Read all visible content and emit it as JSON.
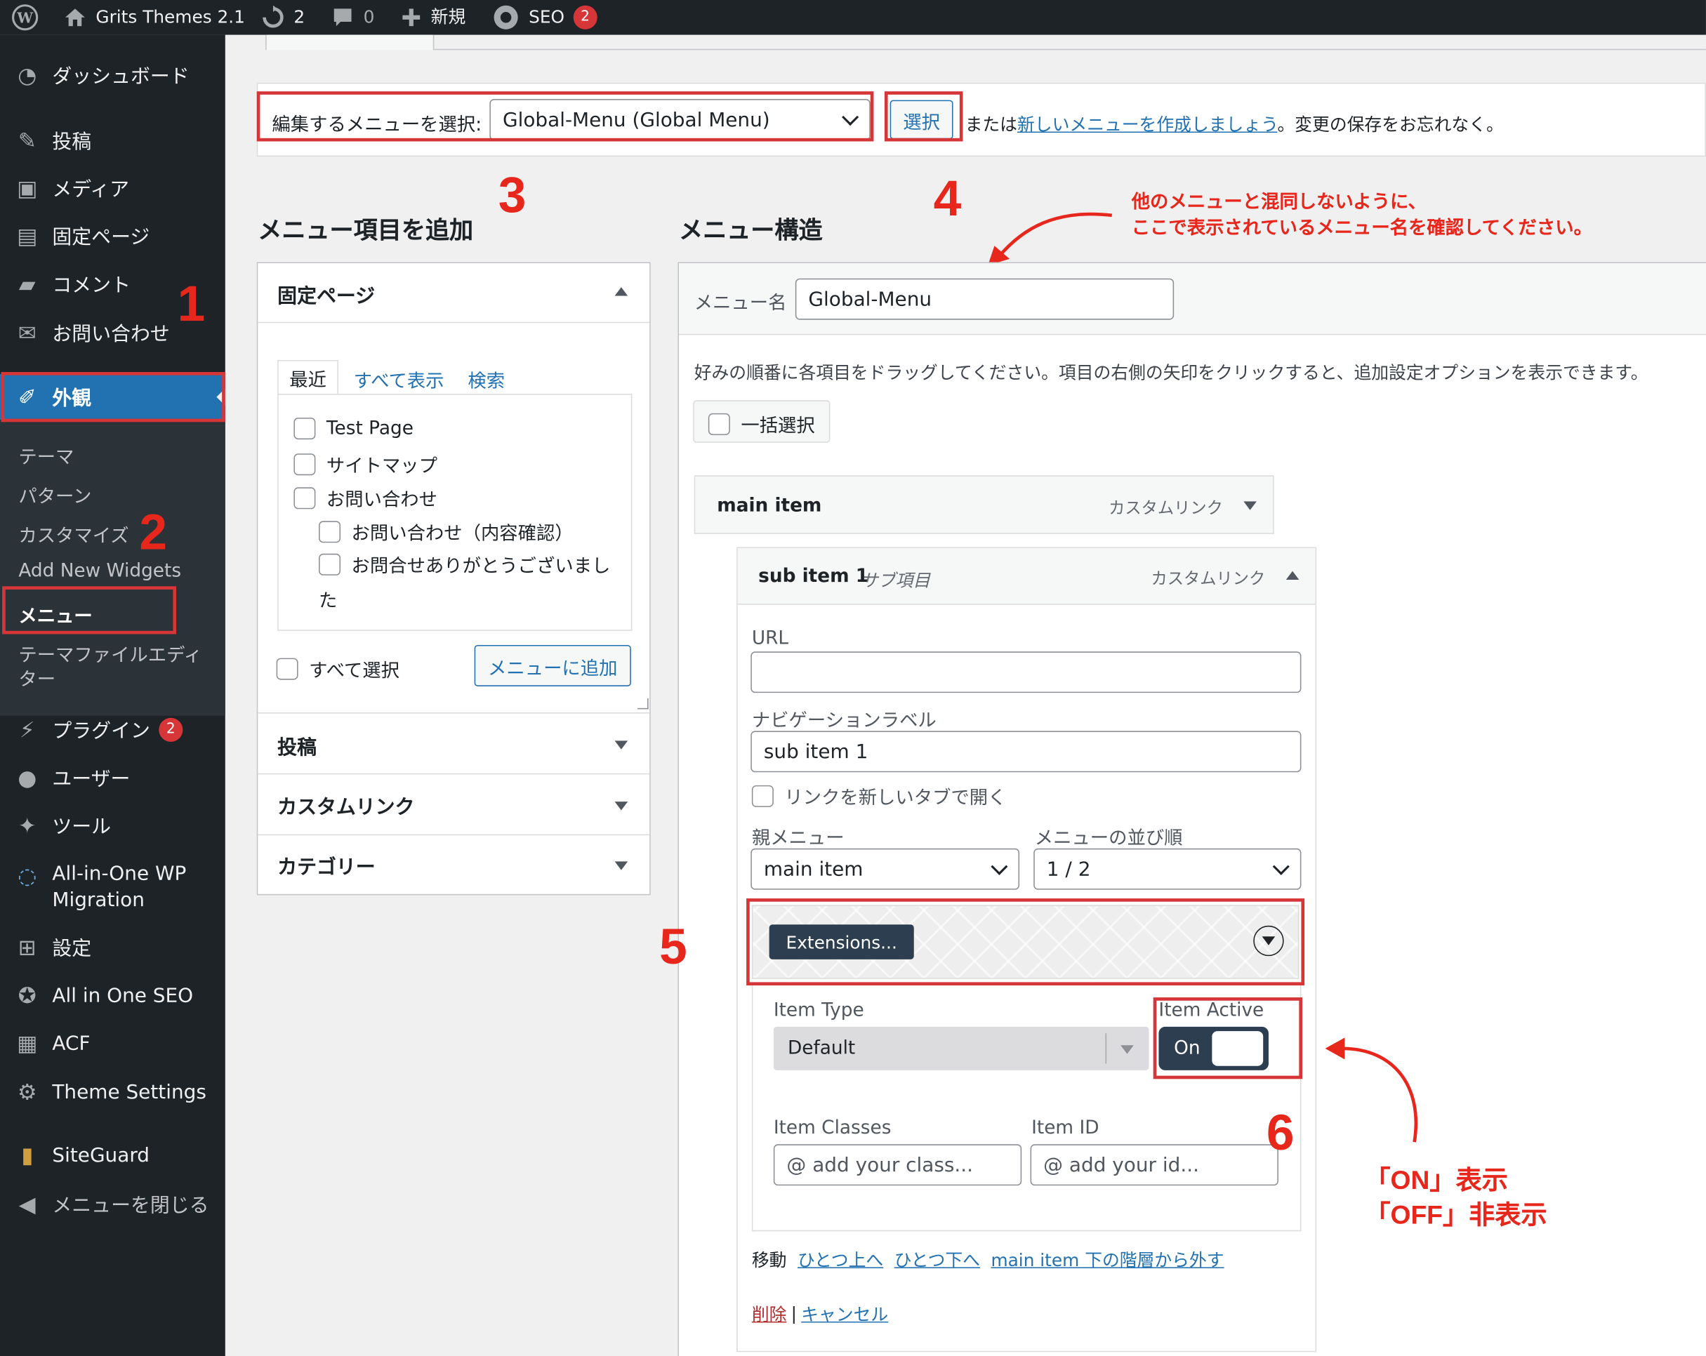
{
  "adminbar": {
    "site_name": "Grits Themes 2.1",
    "updates_count": "2",
    "comments_count": "0",
    "new_label": "新規",
    "seo_label": "SEO",
    "seo_badge": "2"
  },
  "sidebar": {
    "dashboard": "ダッシュボード",
    "posts": "投稿",
    "media": "メディア",
    "pages": "固定ページ",
    "comments": "コメント",
    "contact": "お問い合わせ",
    "appearance": "外観",
    "sub": {
      "themes": "テーマ",
      "patterns": "パターン",
      "customize": "カスタマイズ",
      "widgets": "Add New Widgets",
      "menus": "メニュー",
      "theme_editor_1": "テーマファイルエディ",
      "theme_editor_2": "ター"
    },
    "plugins": "プラグイン",
    "plugins_badge": "2",
    "users": "ユーザー",
    "tools": "ツール",
    "aio_migration_1": "All-in-One WP",
    "aio_migration_2": "Migration",
    "settings": "設定",
    "aioseo": "All in One SEO",
    "acf": "ACF",
    "theme_settings": "Theme Settings",
    "siteguard": "SiteGuard",
    "collapse": "メニューを閉じる"
  },
  "select_menu": {
    "label": "編集するメニューを選択:",
    "value": "Global-Menu (Global Menu)",
    "button": "選択",
    "or_text": "または",
    "create_link": "新しいメニューを作成しましょう",
    "suffix": "。変更の保存をお忘れなく。"
  },
  "add_items": {
    "heading": "メニュー項目を追加",
    "pages_section": "固定ページ",
    "tabs": [
      "最近",
      "すべて表示",
      "検索"
    ],
    "pages": [
      "Test Page",
      "サイトマップ",
      "お問い合わせ"
    ],
    "child_pages": [
      "お問い合わせ（内容確認）",
      "お問合せありがとうございまし"
    ],
    "child_pages_wrap": "た",
    "select_all": "すべて選択",
    "add_button": "メニューに追加",
    "sections": [
      "投稿",
      "カスタムリンク",
      "カテゴリー"
    ]
  },
  "structure": {
    "heading": "メニュー構造",
    "menu_name_label": "メニュー名",
    "menu_name_value": "Global-Menu",
    "instructions": "好みの順番に各項目をドラッグしてください。項目の右側の矢印をクリックすると、追加設定オプションを表示できます。",
    "bulk_select": "一括選択",
    "main_item": {
      "title": "main item",
      "type": "カスタムリンク"
    },
    "sub_item": {
      "title": "sub item 1",
      "subtitle": "サブ項目",
      "type": "カスタムリンク"
    },
    "url_label": "URL",
    "url_value": "",
    "nav_label": "ナビゲーションラベル",
    "nav_value": "sub item 1",
    "new_tab": "リンクを新しいタブで開く",
    "parent_label": "親メニュー",
    "parent_value": "main item",
    "order_label": "メニューの並び順",
    "order_value": "1 / 2",
    "extensions_button": "Extensions...",
    "item_type_label": "Item Type",
    "item_type_value": "Default",
    "item_active_label": "Item Active",
    "item_active_value": "On",
    "item_active_level": 1,
    "item_classes_label": "Item Classes",
    "item_classes_placeholder": "@ add your class...",
    "item_id_label": "Item ID",
    "item_id_placeholder": "@ add your id...",
    "move_label": "移動",
    "move_links": [
      "ひとつ上へ",
      "ひとつ下へ",
      "main item 下の階層から外す"
    ],
    "delete": "削除",
    "separator": "|",
    "cancel": "キャンセル"
  },
  "annotations": {
    "n1": "1",
    "n2": "2",
    "n3": "3",
    "n4": "4",
    "n5": "5",
    "n6": "6",
    "note_line1": "他のメニューと混同しないように、",
    "note_line2": "ここで表示されているメニュー名を確認してください。",
    "onoff_line1": "「ON」表示",
    "onoff_line2": "「OFF」非表示"
  },
  "colors": {
    "admin_bg": "#1d2327",
    "active_menu": "#2271b1",
    "link": "#2271b1",
    "annotation_red": "#e8271c",
    "badge": "#d63638",
    "extensions_bg": "#2c3e50"
  },
  "icons": [
    "wordpress-icon",
    "home-icon",
    "updates-icon",
    "comment-icon",
    "plus-icon",
    "seo-icon",
    "dashboard-icon",
    "pin-icon",
    "media-icon",
    "page-icon",
    "comment-bubble-icon",
    "mail-icon",
    "paintbrush-icon",
    "plugin-icon",
    "user-icon",
    "wrench-icon",
    "migration-icon",
    "settings-icon",
    "aioseo-icon",
    "acf-icon",
    "gear-icon",
    "siteguard-icon",
    "collapse-icon",
    "chevron-down-icon",
    "toggle-arrow-icon"
  ]
}
